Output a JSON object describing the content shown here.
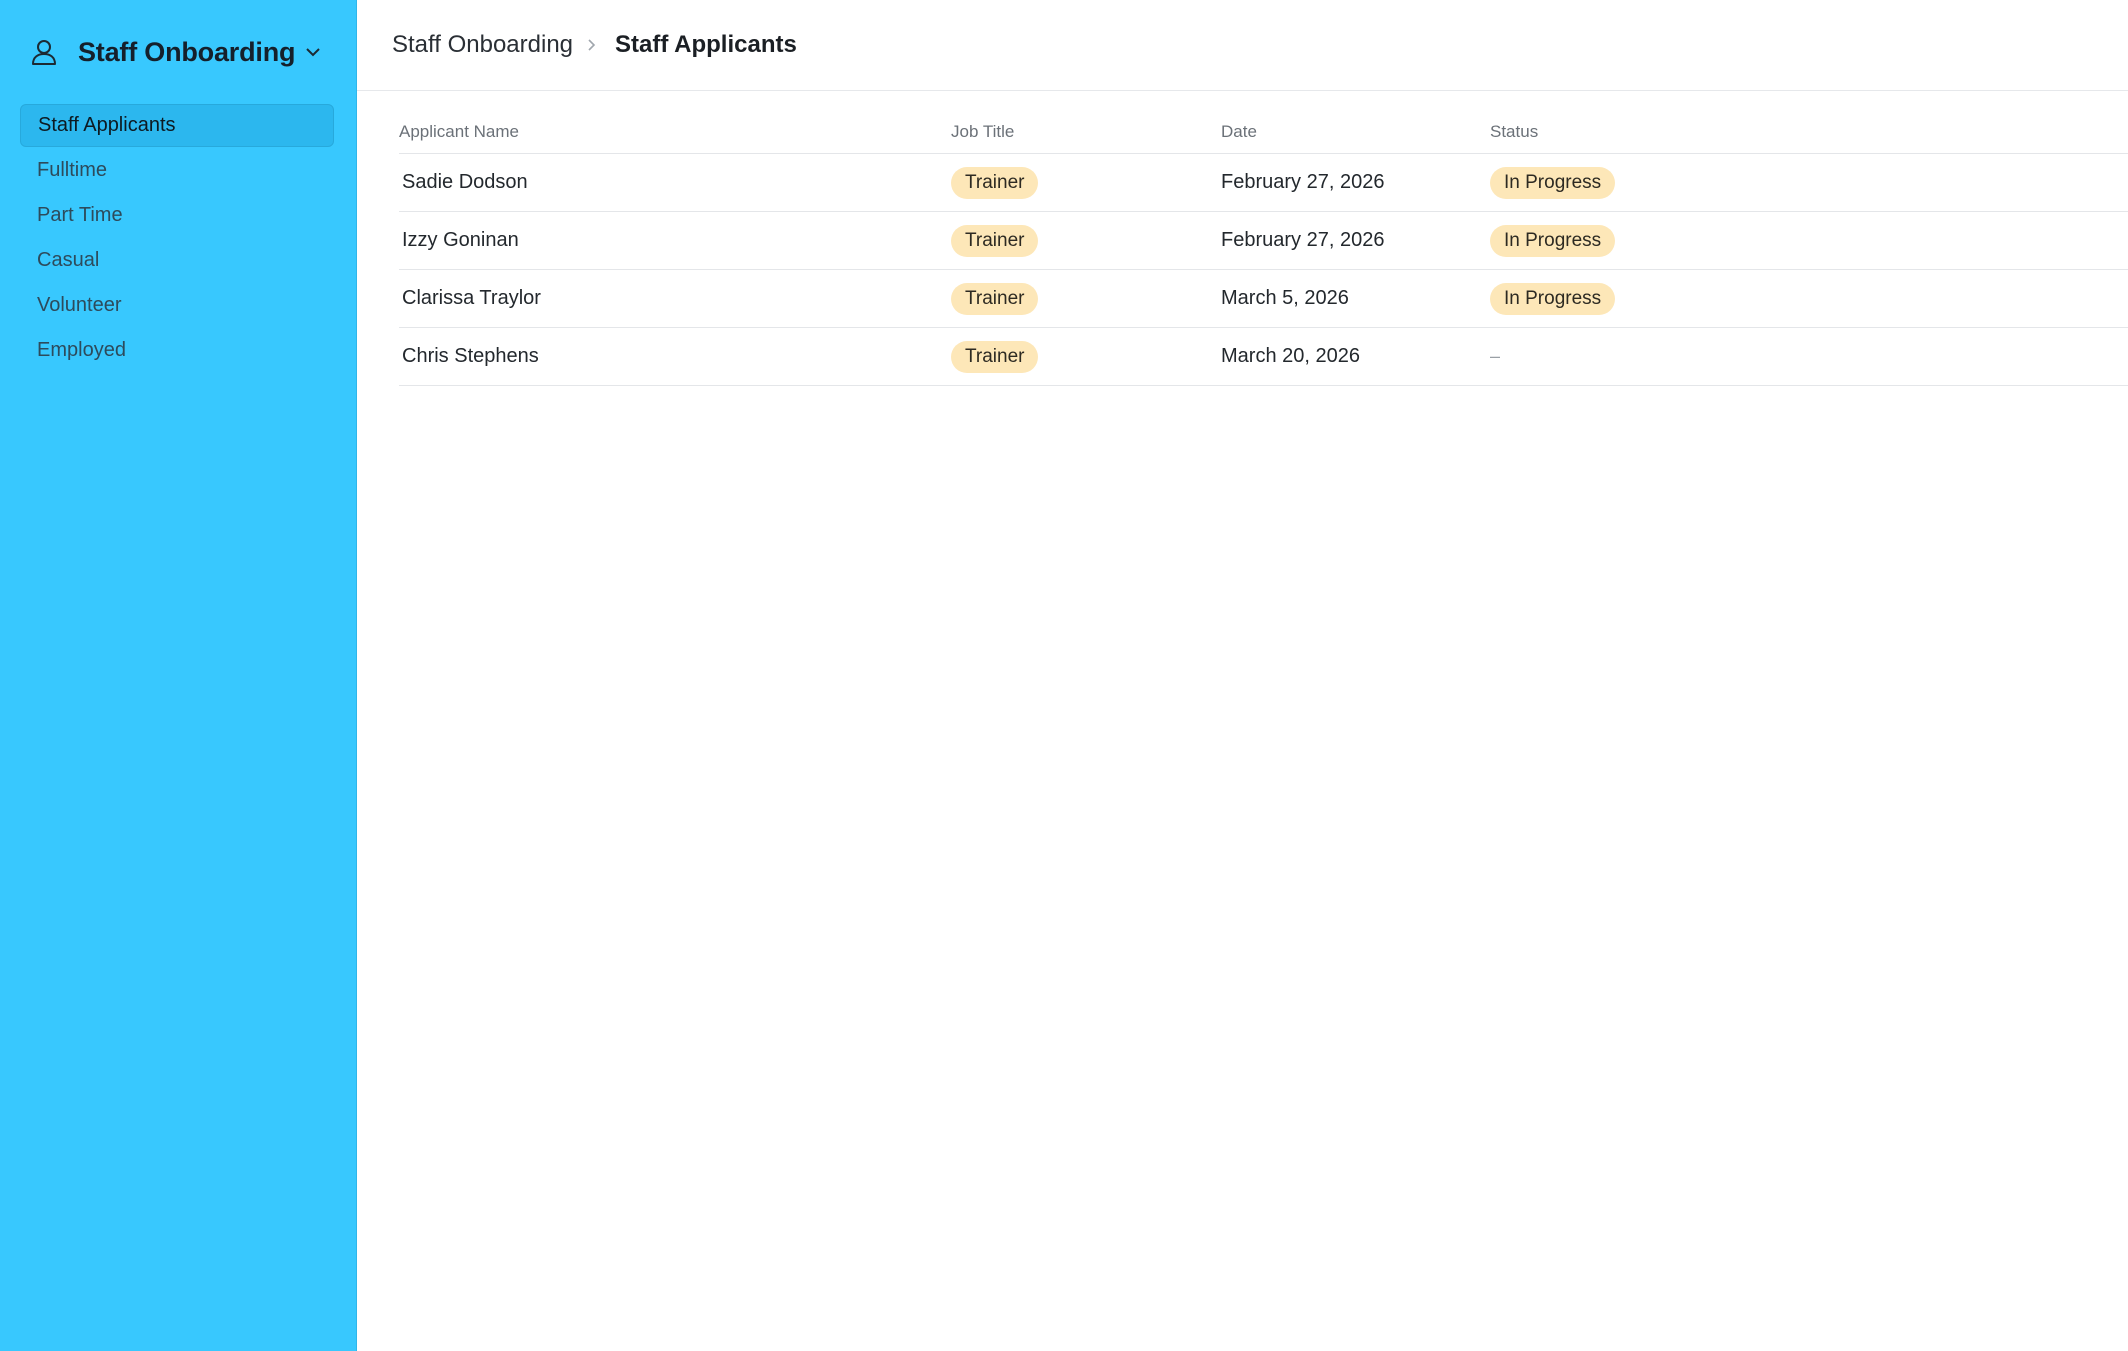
{
  "workspace": {
    "title": "Staff Onboarding",
    "icon": "user-icon",
    "chevron": "chevron-down-icon"
  },
  "sidebar": {
    "items": [
      {
        "label": "Staff Applicants",
        "active": true
      },
      {
        "label": "Fulltime",
        "active": false
      },
      {
        "label": "Part Time",
        "active": false
      },
      {
        "label": "Casual",
        "active": false
      },
      {
        "label": "Volunteer",
        "active": false
      },
      {
        "label": "Employed",
        "active": false
      }
    ]
  },
  "breadcrumb": {
    "root": "Staff Onboarding",
    "separator_icon": "chevron-right-icon",
    "current": "Staff Applicants"
  },
  "table": {
    "columns": [
      "Applicant Name",
      "Job Title",
      "Date",
      "Status"
    ],
    "rows": [
      {
        "name": "Sadie Dodson",
        "job": "Trainer",
        "date": "February 27, 2026",
        "status": "In Progress"
      },
      {
        "name": "Izzy Goninan",
        "job": "Trainer",
        "date": "February 27, 2026",
        "status": "In Progress"
      },
      {
        "name": "Clarissa Traylor",
        "job": "Trainer",
        "date": "March 5, 2026",
        "status": "In Progress"
      },
      {
        "name": "Chris Stephens",
        "job": "Trainer",
        "date": "March 20, 2026",
        "status": "–"
      }
    ]
  },
  "colors": {
    "sidebar_bg": "#38c8fe",
    "active_item_bg": "#2cb7ee",
    "pill_bg": "#fde7b8"
  }
}
